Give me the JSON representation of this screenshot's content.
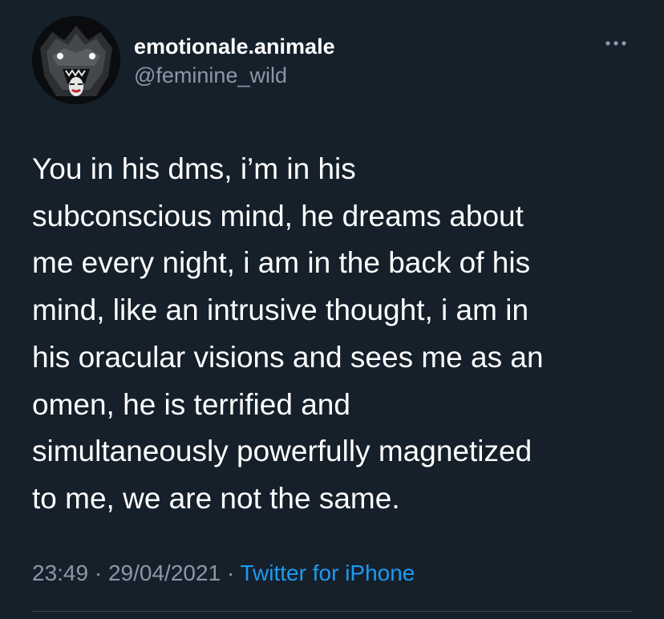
{
  "user": {
    "display_name": "emotionale.animale",
    "handle": "@feminine_wild",
    "avatar_icon": "wolf-avatar-icon"
  },
  "menu": {
    "icon": "more-options-icon"
  },
  "tweet": {
    "lines": [
      "You in his dms, i’m in his",
      "subconscious mind, he dreams about",
      "me every night, i am in the back of his",
      "mind, like an intrusive thought, i am in",
      "his oracular visions and sees me as an",
      "omen, he is terrified and",
      "simultaneously powerfully magnetized",
      "to me, we are not the same."
    ]
  },
  "meta": {
    "time": "23:49",
    "separator": " · ",
    "date": "29/04/2021",
    "source": "Twitter for iPhone"
  },
  "colors": {
    "background": "#15202b",
    "primary_text": "#ffffff",
    "secondary_text": "#8b98a5",
    "link": "#1d9bf0"
  }
}
